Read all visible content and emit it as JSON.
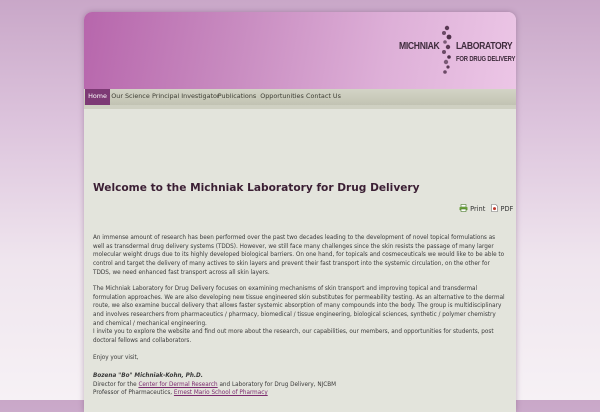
{
  "logo": {
    "word1": "MICHNIAK",
    "word2": "LABORATORY",
    "word3": "FOR DRUG DELIVERY"
  },
  "nav": {
    "items": [
      "Home",
      "Our Science",
      "Principal Investigator",
      "Publications",
      "Opportunities",
      "Contact Us"
    ],
    "active": "Home"
  },
  "content": {
    "title": "Welcome to the Michniak Laboratory for Drug Delivery",
    "tools": {
      "print_label": "Print",
      "pdf_label": "PDF"
    },
    "paragraphs": [
      "An immense amount of research has been performed over the past two decades leading to the development of novel topical formulations as well as transdermal drug delivery systems (TDDS). However, we still face many challenges since the skin resists the passage of many larger molecular weight drugs due to its highly developed biological barriers. On one hand, for topicals and cosmeceuticals we would like to be able to control and target the delivery of many actives to skin layers and prevent their fast transport into the systemic circulation, on the other for TDDS, we need enhanced fast transport across all skin layers.",
      "The Michniak Laboratory for Drug Delivery focuses on examining mechanisms of skin transport and improving topical and transdermal formulation approaches. We are also developing new tissue engineered skin substitutes for permeability testing. As an alternative to the dermal route, we also examine buccal delivery that allows faster systemic absorption of many compounds into the body. The group is multidisciplinary and involves researchers from pharmaceutics / pharmacy, biomedical / tissue engineering, biological sciences, synthetic / polymer chemistry and chemical / mechanical engineering.",
      "I invite you to explore the website and find out more about the research, our capabilities, our members, and opportunities for students, post doctoral fellows and collaborators.",
      "Enjoy your visit,"
    ],
    "signature": {
      "name": "Bozena \"Bo\" Michniak-Kohn, Ph.D.",
      "line1_prefix": "Director for the ",
      "line1_link": "Center for Dermal Research",
      "line1_suffix": " and Laboratory for Drug Delivery, NJCBM",
      "line2_prefix": "Professor of Pharmaceutics, ",
      "line2_link": "Ernest Mario School of Pharmacy"
    }
  },
  "colors": {
    "header_start": "#b766ac",
    "header_end": "#ecc6e6",
    "nav_active": "#7d3a75",
    "title": "#3b1f34",
    "link": "#7b2a6e",
    "content_bg": "#e3e4dc"
  }
}
